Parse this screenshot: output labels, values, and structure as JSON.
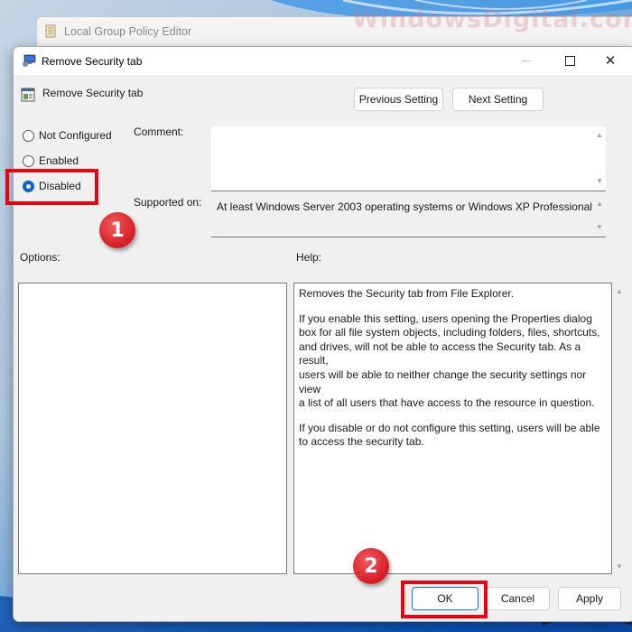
{
  "watermark": "WindowsDigital.com",
  "background_window": {
    "title": "Local Group Policy Editor",
    "icon": "scroll-icon"
  },
  "dialog": {
    "title": "Remove Security tab",
    "title_icon": "policy-computer-icon",
    "window_controls": {
      "minimize_icon": "minimize-icon",
      "maximize_icon": "maximize-icon",
      "close_icon": "close-icon",
      "close_glyph": "✕"
    },
    "setting_name": "Remove Security tab",
    "setting_icon": "policy-setting-icon",
    "nav_buttons": {
      "previous": "Previous Setting",
      "next": "Next Setting"
    },
    "state_options": [
      {
        "label": "Not Configured",
        "checked": false
      },
      {
        "label": "Enabled",
        "checked": false
      },
      {
        "label": "Disabled",
        "checked": true
      }
    ],
    "comment": {
      "label": "Comment:",
      "value": ""
    },
    "supported_on": {
      "label": "Supported on:",
      "value": "At least Windows Server 2003 operating systems or Windows XP Professional"
    },
    "options_label": "Options:",
    "help_label": "Help:",
    "help_paragraphs": [
      "Removes the Security tab from File Explorer.",
      "If you enable this setting, users opening the Properties dialog\nbox for all file system objects, including folders, files, shortcuts,\nand drives, will not be able to access the Security tab. As a result,\nusers will be able to neither change the security settings nor view\na list of all users that have access to the resource in question.",
      "If you disable or do not configure this setting, users will be able\nto access the security tab."
    ],
    "footer_buttons": {
      "ok": "OK",
      "cancel": "Cancel",
      "apply": "Apply"
    },
    "scroll_up_glyph": "▲",
    "scroll_down_glyph": "▼"
  },
  "annotations": {
    "step1": "1",
    "step2": "2",
    "highlight_color": "#e3050f"
  },
  "colors": {
    "accent": "#0a64c0",
    "dialog_bg": "#f0f0f0",
    "badge": "#d41c24"
  }
}
